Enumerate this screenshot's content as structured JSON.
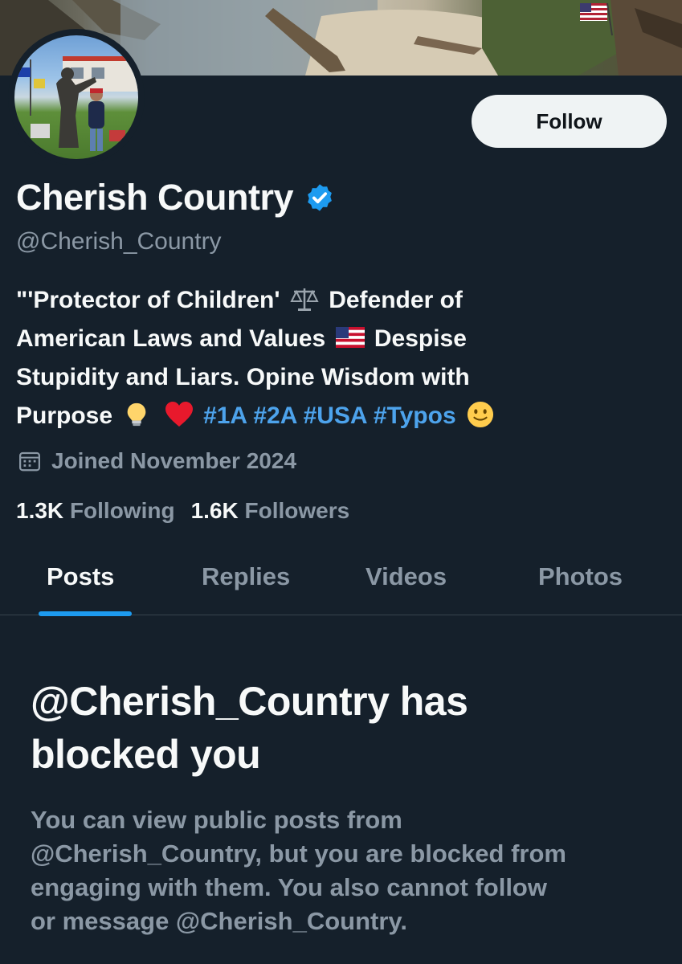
{
  "profile": {
    "display_name": "Cherish Country",
    "handle": "@Cherish_Country",
    "follow_label": "Follow",
    "bio": {
      "line1_text": "\"'Protector of Children'",
      "line1_emoji": "scales-emoji",
      "line1_tail": "Defender of",
      "line2_text": "American Laws and Values",
      "line2_emoji": "us-flag-emoji",
      "line2_tail": "Despise",
      "line3_text": "Stupidity and Liars. Opine Wisdom with",
      "line4_text": "Purpose",
      "line4_emojis": [
        "lightbulb-emoji",
        "red-heart-emoji"
      ],
      "hashtags": "#1A #2A #USA #Typos",
      "line4_end_emoji": "slightly-smiling-face-emoji"
    },
    "joined": "Joined November 2024",
    "following_count": "1.3K",
    "following_label": "Following",
    "followers_count": "1.6K",
    "followers_label": "Followers"
  },
  "tabs": [
    {
      "label": "Posts",
      "active": true
    },
    {
      "label": "Replies",
      "active": false
    },
    {
      "label": "Videos",
      "active": false
    },
    {
      "label": "Photos",
      "active": false
    }
  ],
  "blocked": {
    "title_line1": "@Cherish_Country has",
    "title_line2": "blocked you",
    "desc_line1": "You can view public posts from",
    "desc_line2": "@Cherish_Country, but you are blocked from",
    "desc_line3": "engaging with them. You also cannot follow",
    "desc_line4": "or message @Cherish_Country."
  },
  "colors": {
    "background": "#15202b",
    "accent": "#1d9bf0",
    "hashtag": "#4da3ec",
    "muted_text": "#8b98a5"
  }
}
